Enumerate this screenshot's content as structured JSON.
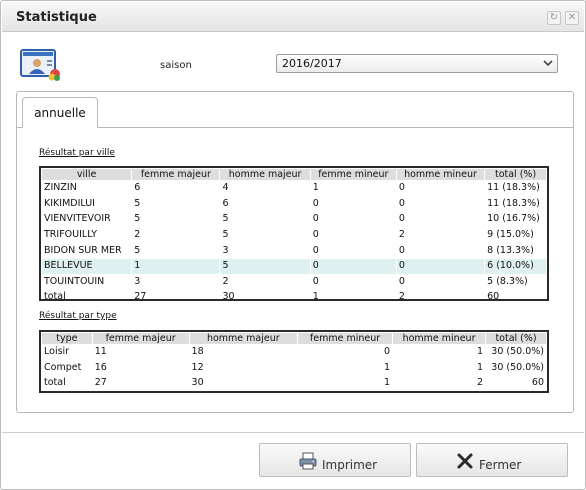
{
  "window": {
    "title": "Statistique"
  },
  "icons": {
    "refresh": "↻",
    "close": "✕"
  },
  "filter": {
    "saison_label": "saison",
    "saison_value": "2016/2017"
  },
  "tabs": [
    {
      "label": "annuelle",
      "active": true
    }
  ],
  "ville_section": {
    "title": "Résultat par ville",
    "headers": [
      "ville",
      "femme majeur",
      "homme majeur",
      "femme mineur",
      "homme mineur",
      "total (%)"
    ],
    "rows": [
      [
        "ZINZIN",
        "6",
        "4",
        "1",
        "0",
        "11 (18.3%)"
      ],
      [
        "KIKIMDILUI",
        "5",
        "6",
        "0",
        "0",
        "11 (18.3%)"
      ],
      [
        "VIENVITEVOIR",
        "5",
        "5",
        "0",
        "0",
        "10 (16.7%)"
      ],
      [
        "TRIFOUILLY",
        "2",
        "5",
        "0",
        "2",
        "9 (15.0%)"
      ],
      [
        "BIDON SUR MER",
        "5",
        "3",
        "0",
        "0",
        "8 (13.3%)"
      ],
      [
        "BELLEVUE",
        "1",
        "5",
        "0",
        "0",
        "6 (10.0%)"
      ],
      [
        "TOUINTOUIN",
        "3",
        "2",
        "0",
        "0",
        "5 (8.3%)"
      ],
      [
        "total",
        "27",
        "30",
        "1",
        "2",
        "60"
      ]
    ],
    "highlighted_row": "BELLEVUE"
  },
  "type_section": {
    "title": "Résultat par type",
    "headers": [
      "type",
      "femme majeur",
      "homme majeur",
      "femme mineur",
      "homme mineur",
      "total (%)"
    ],
    "rows": [
      [
        "Loisir",
        "11",
        "18",
        "0",
        "1",
        "30 (50.0%)"
      ],
      [
        "Compet",
        "16",
        "12",
        "1",
        "1",
        "30 (50.0%)"
      ],
      [
        "total",
        "27",
        "30",
        "1",
        "2",
        "60"
      ]
    ]
  },
  "buttons": {
    "print": "Imprimer",
    "close": "Fermer"
  },
  "colors": {
    "highlight_row": "#dff0f0",
    "header_bg": "#dddddd"
  }
}
